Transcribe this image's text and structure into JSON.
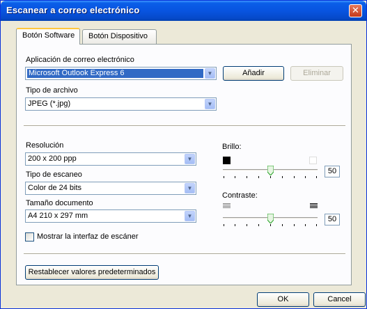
{
  "window": {
    "title": "Escanear a correo electrónico",
    "close_glyph": "✕"
  },
  "tabs": [
    {
      "label": "Botón Software",
      "active": true
    },
    {
      "label": "Botón Dispositivo",
      "active": false
    }
  ],
  "email_app": {
    "label": "Aplicación de correo electrónico",
    "value": "Microsoft Outlook Express 6",
    "add_label": "Añadir",
    "remove_label": "Eliminar"
  },
  "file_type": {
    "label": "Tipo de archivo",
    "value": "JPEG (*.jpg)"
  },
  "resolution": {
    "label": "Resolución",
    "value": "200 x 200 ppp"
  },
  "scan_type": {
    "label": "Tipo de escaneo",
    "value": "Color de 24 bits"
  },
  "doc_size": {
    "label": "Tamaño documento",
    "value": "A4 210 x 297 mm"
  },
  "brightness": {
    "label": "Brillo:",
    "value": "50",
    "level": 0.5
  },
  "contrast": {
    "label": "Contraste:",
    "value": "50",
    "level": 0.5
  },
  "show_interface": {
    "label": "Mostrar la interfaz de escáner",
    "checked": false
  },
  "reset_label": "Restablecer valores predeterminados",
  "ok_label": "OK",
  "cancel_label": "Cancel",
  "colors": {
    "title_bar": "#0a5ee8",
    "dialog_bg": "#ece9d8",
    "selection": "#316ac5",
    "active_tab_accent": "#ffc73c",
    "thumb_green": "#21a121"
  }
}
